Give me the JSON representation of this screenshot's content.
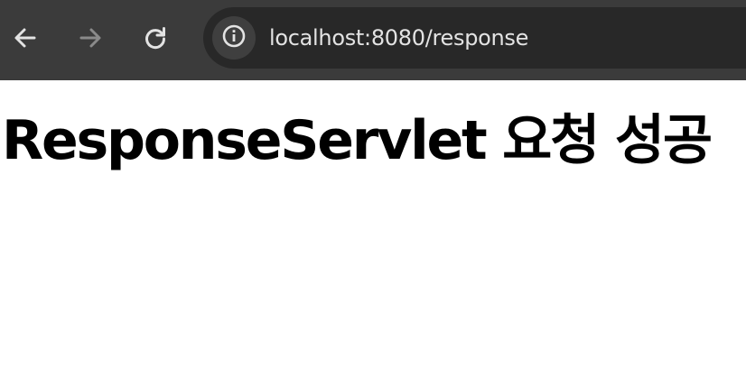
{
  "browser": {
    "toolbar": {
      "back_icon": "arrow-left-icon",
      "forward_icon": "arrow-right-icon",
      "reload_icon": "reload-icon",
      "site_info_icon": "info-circle-icon"
    },
    "address_bar": {
      "url": "localhost:8080/response"
    },
    "colors": {
      "toolbar_bg": "#3b3b3b",
      "omnibox_bg": "#282828",
      "icon_active": "#e3e3e3",
      "icon_disabled": "#8a8a8a"
    }
  },
  "page": {
    "heading": "ResponseServlet 요청 성공"
  }
}
